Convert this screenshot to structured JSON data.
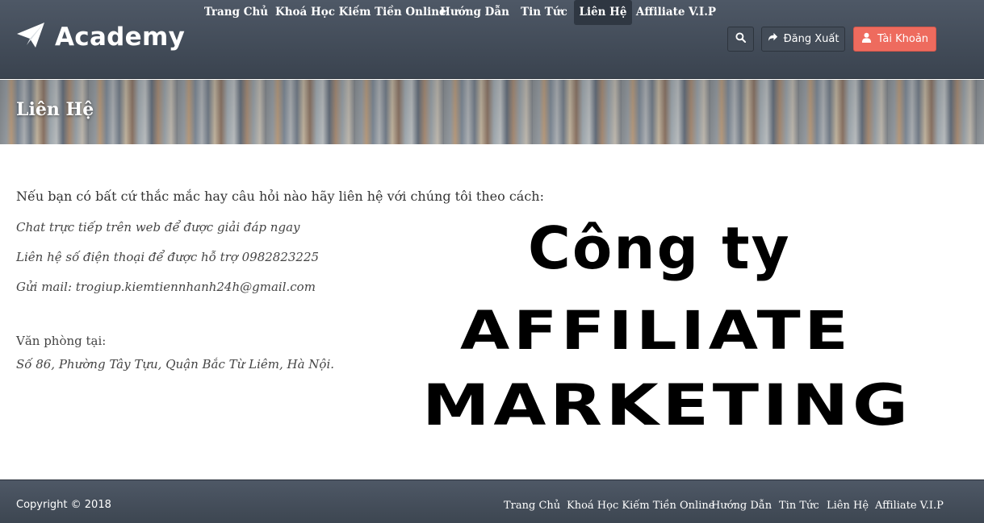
{
  "header": {
    "logo_text": "Academy",
    "nav": [
      {
        "label": "Trang Chủ"
      },
      {
        "label": "Khoá Học Kiếm Tiền Online"
      },
      {
        "label": "Hướng Dẫn"
      },
      {
        "label": "Tin Tức"
      },
      {
        "label": "Liên Hệ",
        "active": true
      },
      {
        "label": "Affiliate V.I.P"
      }
    ],
    "logout_label": "Đăng Xuất",
    "account_label": "Tài Khoản",
    "colors": {
      "header_bg": "#434c58",
      "account_btn": "#ee6b5e"
    }
  },
  "banner": {
    "title": "Liên Hệ"
  },
  "content": {
    "intro": "Nếu bạn có bất cứ thắc mắc hay câu hỏi nào hãy liên hệ với chúng tôi theo cách:",
    "lines": [
      "Chat trực tiếp trên web để được giải đáp ngay",
      "Liên hệ số điện thoại để được hỗ trợ 0982823225",
      "Gửi mail: trogiup.kiemtiennhanh24h@gmail.com"
    ],
    "office_label": "Văn phòng tại:",
    "office_address": "Số 86, Phường Tây Tựu, Quận Bắc Từ Liêm, Hà Nội."
  },
  "promo": {
    "line1": "Công ty",
    "line2": "AFFILIATE",
    "line3": "MARKETING"
  },
  "footer": {
    "copyright": "Copyright © 2018",
    "links": [
      "Trang Chủ",
      "Khoá Học Kiếm Tiền Online",
      "Hướng Dẫn",
      "Tin Tức",
      "Liên Hệ",
      "Affiliate V.I.P"
    ]
  }
}
